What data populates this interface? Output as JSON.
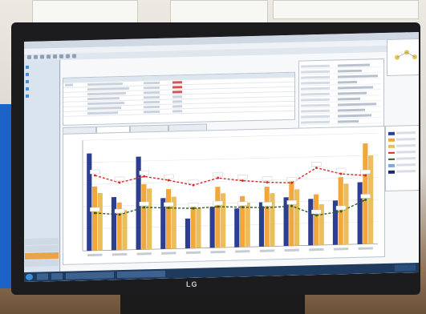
{
  "photo": {
    "monitor_brand": "LG"
  },
  "app": {
    "window_title": "",
    "menu": []
  },
  "chart_data": {
    "type": "bar",
    "categories": [
      "1",
      "2",
      "3",
      "4",
      "5",
      "6",
      "7",
      "8",
      "9",
      "10",
      "11",
      "12"
    ],
    "series": [
      {
        "values": [
          88,
          48,
          84,
          46,
          27,
          37,
          35,
          40,
          44,
          42,
          40,
          56
        ]
      },
      {
        "values": [
          58,
          43,
          59,
          54,
          41,
          55,
          46,
          54,
          58,
          46,
          61,
          91
        ]
      },
      {
        "values": [
          52,
          36,
          55,
          47,
          36,
          49,
          40,
          48,
          51,
          37,
          55,
          80
        ]
      }
    ],
    "lines": [
      {
        "values": [
          68,
          61,
          66,
          62,
          57,
          63,
          60,
          58,
          57,
          70,
          64,
          62
        ]
      },
      {
        "values": [
          34,
          32,
          38,
          37,
          36,
          37,
          36,
          35,
          36,
          27,
          30,
          40
        ]
      }
    ],
    "ylim": [
      0,
      100
    ],
    "grid": true,
    "legend_position": "right"
  },
  "colors": {
    "bar_navy": "#2b3e8f",
    "bar_orange": "#f3a63c",
    "bar_gold": "#e8bf5a",
    "line_red": "#d6292a",
    "line_green": "#2f5d2a"
  }
}
